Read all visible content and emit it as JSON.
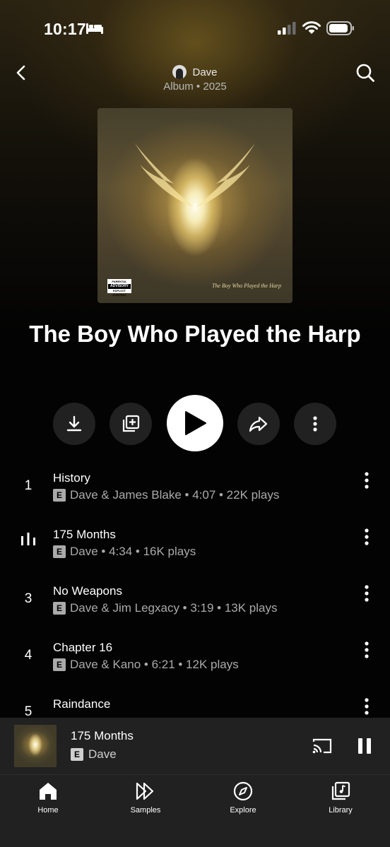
{
  "status_bar": {
    "time": "10:17",
    "icons": [
      "bed-icon",
      "cellular-signal-icon",
      "wifi-icon",
      "battery-icon"
    ]
  },
  "header": {
    "artist": "Dave",
    "subtitle": "Album • 2025",
    "icons": [
      "back-arrow-icon",
      "search-icon"
    ]
  },
  "album": {
    "title": "The Boy Who Played the Harp",
    "cover_text": "The Boy Who Played the Harp",
    "advisory_top": "PARENTAL",
    "advisory_mid": "ADVISORY",
    "advisory_bottom": "EXPLICIT CONTENT"
  },
  "actions": {
    "icons": [
      "download-icon",
      "add-to-playlist-icon",
      "play-icon",
      "share-icon",
      "more-vert-icon"
    ]
  },
  "tracks": [
    {
      "num": "1",
      "title": "History",
      "badge": "E",
      "meta": "Dave & James Blake • 4:07 • 22K plays",
      "playing": false
    },
    {
      "num": "",
      "title": "175 Months",
      "badge": "E",
      "meta": "Dave • 4:34 • 16K plays",
      "playing": true
    },
    {
      "num": "3",
      "title": "No Weapons",
      "badge": "E",
      "meta": "Dave & Jim Legxacy • 3:19 • 13K plays",
      "playing": false
    },
    {
      "num": "4",
      "title": "Chapter 16",
      "badge": "E",
      "meta": "Dave & Kano • 6:21 • 12K plays",
      "playing": false
    },
    {
      "num": "5",
      "title": "Raindance",
      "badge": "",
      "meta": "",
      "playing": false
    }
  ],
  "mini_player": {
    "title": "175 Months",
    "badge": "E",
    "artist": "Dave",
    "icons": [
      "cast-icon",
      "pause-icon"
    ]
  },
  "bottom_nav": [
    {
      "label": "Home",
      "icon": "home-icon"
    },
    {
      "label": "Samples",
      "icon": "samples-icon"
    },
    {
      "label": "Explore",
      "icon": "explore-icon"
    },
    {
      "label": "Library",
      "icon": "library-icon"
    }
  ]
}
